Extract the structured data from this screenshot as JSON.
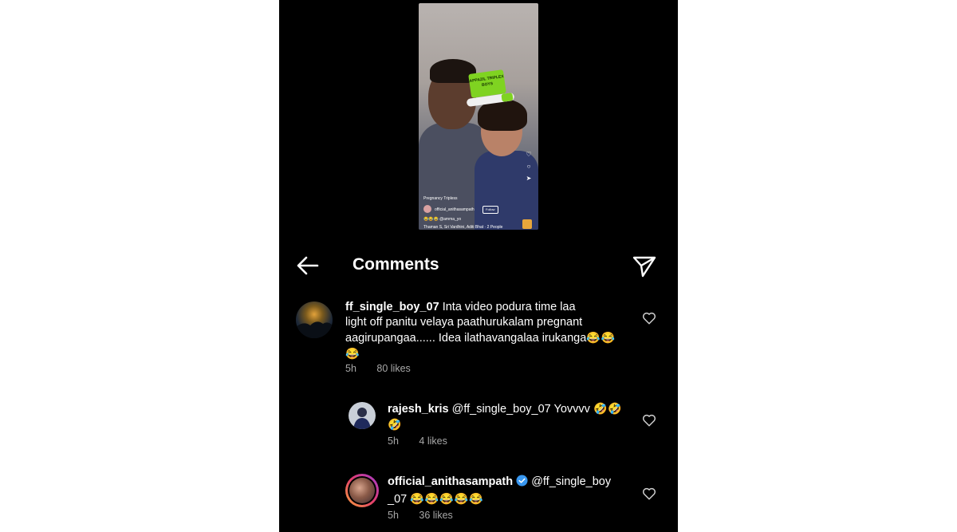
{
  "video": {
    "sticker_text": "APPAZIL TRIPLEX BOYS",
    "song": "Pregnancy Tripless",
    "username": "official_anithasampath",
    "follow_label": "Follow",
    "caption": "😂😂😂 @amma_yo",
    "tagged": "Thaman S, Sri Vardhini, Aditi Bhat · 2 People"
  },
  "header": {
    "title": "Comments"
  },
  "comments": [
    {
      "username": "ff_single_boy_07",
      "line1": "Inta video podura time laa",
      "line2": "light off panitu velaya paathurukalam pregnant",
      "line3": "aagirupangaa...... Idea ilathavangalaa irukanga",
      "line3_emoji": "😂😂",
      "line4_emoji": "😂",
      "time": "5h",
      "likes": "80 likes"
    },
    {
      "username": "rajesh_kris",
      "text": "@ff_single_boy_07 Yovvvv",
      "text_emoji": "🤣🤣",
      "line2_emoji": "🤣",
      "time": "5h",
      "likes": "4 likes"
    },
    {
      "username": "official_anithasampath",
      "text": "@ff_single_boy",
      "line2": "_07",
      "line2_emoji": "😂😂😂😂😂",
      "time": "5h",
      "likes": "36 likes"
    }
  ],
  "colors": {
    "background": "#000000",
    "text": "#ffffff",
    "meta": "#a8a8a8",
    "verified": "#3897f0"
  }
}
